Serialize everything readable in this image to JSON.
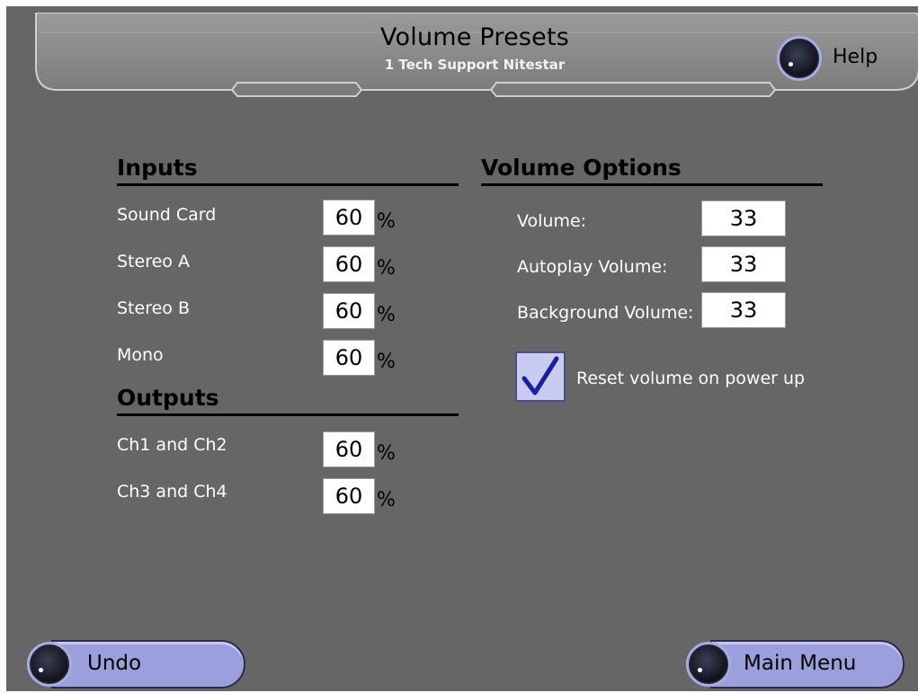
{
  "header": {
    "title": "Volume Presets",
    "subtitle": "1 Tech Support Nitestar",
    "help_label": "Help"
  },
  "inputs": {
    "title": "Inputs",
    "rows": [
      {
        "label": "Sound Card",
        "value": "60",
        "unit": "%"
      },
      {
        "label": "Stereo A",
        "value": "60",
        "unit": "%"
      },
      {
        "label": "Stereo B",
        "value": "60",
        "unit": "%"
      },
      {
        "label": "Mono",
        "value": "60",
        "unit": "%"
      }
    ]
  },
  "outputs": {
    "title": "Outputs",
    "rows": [
      {
        "label": "Ch1 and Ch2",
        "value": "60",
        "unit": "%"
      },
      {
        "label": "Ch3 and Ch4",
        "value": "60",
        "unit": "%"
      }
    ]
  },
  "volume_options": {
    "title": "Volume Options",
    "rows": [
      {
        "label": "Volume:",
        "value": "33"
      },
      {
        "label": "Autoplay Volume:",
        "value": "33"
      },
      {
        "label": "Background Volume:",
        "value": "33"
      }
    ],
    "reset_checkbox": {
      "label": "Reset volume on power up",
      "checked": true
    }
  },
  "footer": {
    "undo_label": "Undo",
    "main_menu_label": "Main Menu"
  },
  "colors": {
    "background": "#666666",
    "header_bar": "#8a8a8a",
    "button_fill": "#9b9fdc",
    "text_light": "#ffffff"
  }
}
